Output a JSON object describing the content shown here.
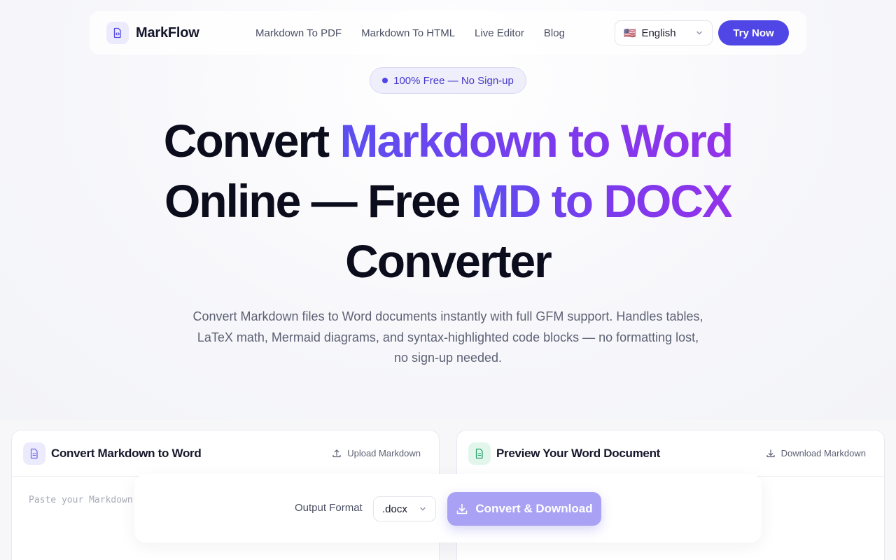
{
  "brand": {
    "name": "MarkFlow"
  },
  "nav": {
    "links": [
      "Markdown To PDF",
      "Markdown To HTML",
      "Live Editor",
      "Blog"
    ],
    "language": {
      "flag": "🇺🇸",
      "label": "English"
    },
    "cta": "Try Now"
  },
  "badge": "100% Free — No Sign-up",
  "hero": {
    "title_part1": "Convert ",
    "title_highlight1": "Markdown to Word",
    "title_part2": "Online — Free ",
    "title_highlight2": "MD to DOCX",
    "title_part3": "Converter",
    "subtitle": "Convert Markdown files to Word documents instantly with full GFM support. Handles tables, LaTeX math, Mermaid diagrams, and syntax-highlighted code blocks — no formatting lost, no sign-up needed."
  },
  "editor_panel": {
    "title": "Convert Markdown to Word",
    "action": "Upload Markdown",
    "placeholder": "Paste your Markdown here..."
  },
  "preview_panel": {
    "title": "Preview Your Word Document",
    "action": "Download Markdown"
  },
  "convert": {
    "format_label": "Output Format",
    "format_value": ".docx",
    "button": "Convert & Download"
  },
  "colors": {
    "accent": "#4f46e5",
    "gradient_start": "#5b4ff0",
    "gradient_end": "#9333ea",
    "convert_button": "#a8a1f4"
  }
}
